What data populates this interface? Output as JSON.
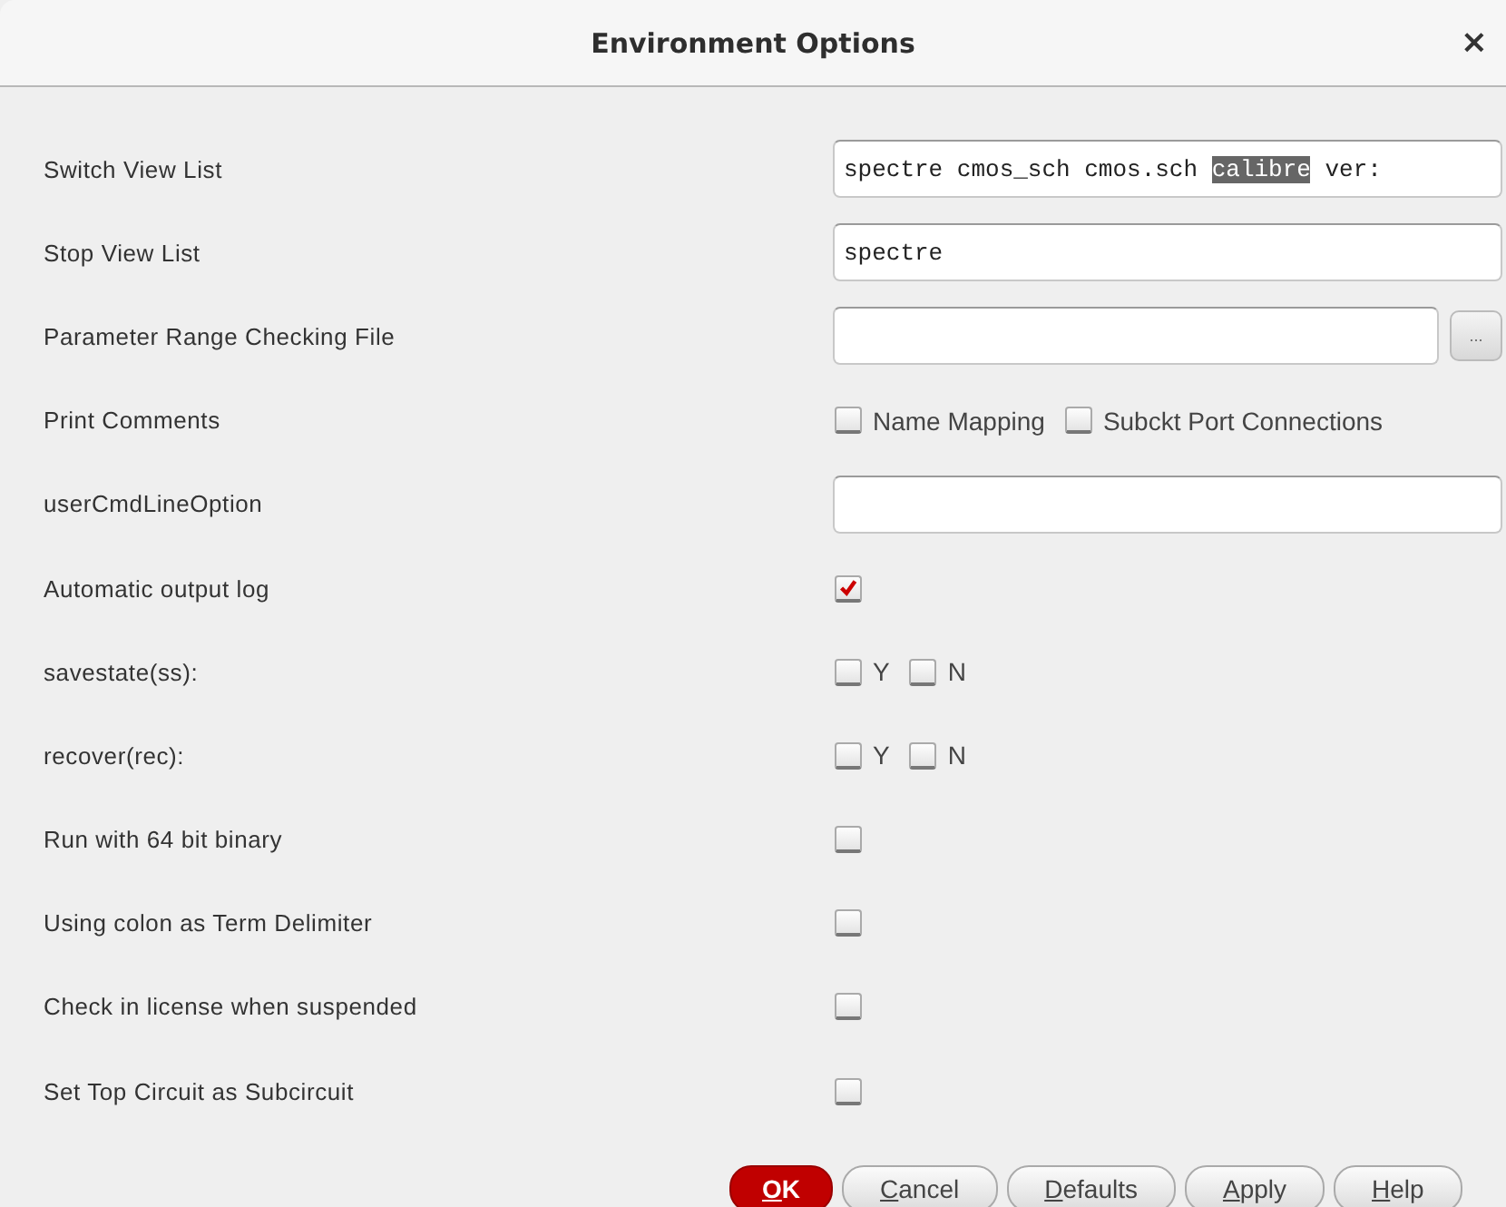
{
  "window": {
    "title": "Environment Options",
    "close": "×"
  },
  "rows": [
    {
      "kind": "text",
      "label": "Switch View List",
      "field": {
        "value_before": "spectre cmos_sch cmos.sch ",
        "selected_text": "calibre",
        "value_after": " ver:"
      }
    },
    {
      "kind": "text",
      "label": "Stop View List",
      "field": {
        "value_before": "spectre"
      }
    },
    {
      "kind": "file",
      "label": "Parameter Range Checking File",
      "field": {},
      "browse": "..."
    },
    {
      "kind": "options",
      "label": "Print Comments",
      "options": [
        {
          "label": "Name Mapping",
          "checked": false
        },
        {
          "label": "Subckt Port Connections",
          "checked": false
        }
      ]
    },
    {
      "kind": "text",
      "label": "userCmdLineOption",
      "field": {}
    },
    {
      "kind": "options",
      "label": "Automatic output log",
      "options": [
        {
          "checked": true
        }
      ]
    },
    {
      "kind": "options",
      "label": "savestate(ss):",
      "options": [
        {
          "label": "Y",
          "checked": false
        },
        {
          "label": "N",
          "checked": false
        }
      ]
    },
    {
      "kind": "options",
      "label": "recover(rec):",
      "options": [
        {
          "label": "Y",
          "checked": false
        },
        {
          "label": "N",
          "checked": false
        }
      ]
    },
    {
      "kind": "options",
      "label": "Run with 64 bit binary",
      "options": [
        {
          "checked": false
        }
      ]
    },
    {
      "kind": "options",
      "label": "Using colon as Term Delimiter",
      "options": [
        {
          "checked": false
        }
      ]
    },
    {
      "kind": "options",
      "label": "Check in license when suspended",
      "options": [
        {
          "checked": false
        }
      ]
    },
    {
      "kind": "options",
      "label": "Set Top Circuit as Subcircuit",
      "options": [
        {
          "checked": false
        }
      ]
    }
  ],
  "buttons": [
    {
      "mnemonic": "O",
      "rest": "K",
      "kind": "default"
    },
    {
      "mnemonic": "C",
      "rest": "ancel",
      "kind": "normal"
    },
    {
      "mnemonic": "D",
      "rest": "efaults",
      "kind": "normal"
    },
    {
      "mnemonic": "A",
      "rest": "pply",
      "kind": "normal"
    },
    {
      "mnemonic": "H",
      "rest": "elp",
      "kind": "normal"
    }
  ]
}
